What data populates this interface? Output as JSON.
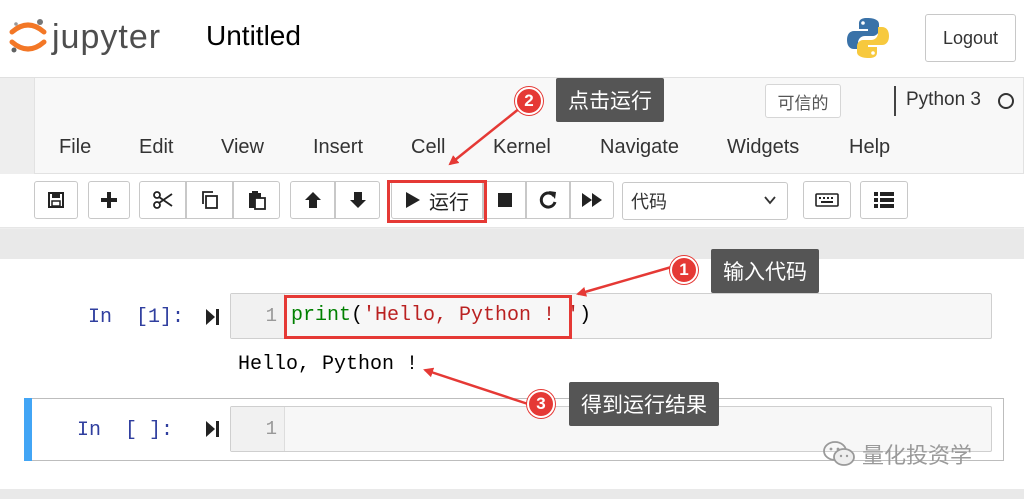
{
  "header": {
    "logo_text": "jupyter",
    "notebook_title": "Untitled",
    "logout_label": "Logout"
  },
  "menubar": {
    "trusted_label": "可信的",
    "kernel_name": "Python 3",
    "items": [
      "File",
      "Edit",
      "View",
      "Insert",
      "Cell",
      "Kernel",
      "Navigate",
      "Widgets",
      "Help"
    ]
  },
  "toolbar": {
    "icons": [
      "save-icon",
      "plus-icon",
      "scissors-icon",
      "copy-icon",
      "paste-icon",
      "arrow-up-icon",
      "arrow-down-icon",
      "play-icon",
      "stop-icon",
      "restart-icon",
      "fast-forward-icon",
      "keyboard-icon",
      "list-icon"
    ],
    "run_label": "运行",
    "cell_type_selected": "代码"
  },
  "cells": [
    {
      "prompt": "In  [1]:",
      "line_number": "1",
      "code_keyword": "print",
      "code_open": "(",
      "code_string": "'Hello, Python ! '",
      "code_close": ")",
      "output": "Hello, Python !"
    },
    {
      "prompt": "In  [ ]:",
      "line_number": "1"
    }
  ],
  "annotations": [
    {
      "number": "1",
      "text": "输入代码"
    },
    {
      "number": "2",
      "text": "点击运行"
    },
    {
      "number": "3",
      "text": "得到运行结果"
    }
  ],
  "watermark": {
    "text": "量化投资学"
  },
  "colors": {
    "annotation_red": "#e53935",
    "callout_bg": "#555555",
    "selected_cell_bar": "#42a5f5",
    "prompt_blue": "#303f9f"
  }
}
